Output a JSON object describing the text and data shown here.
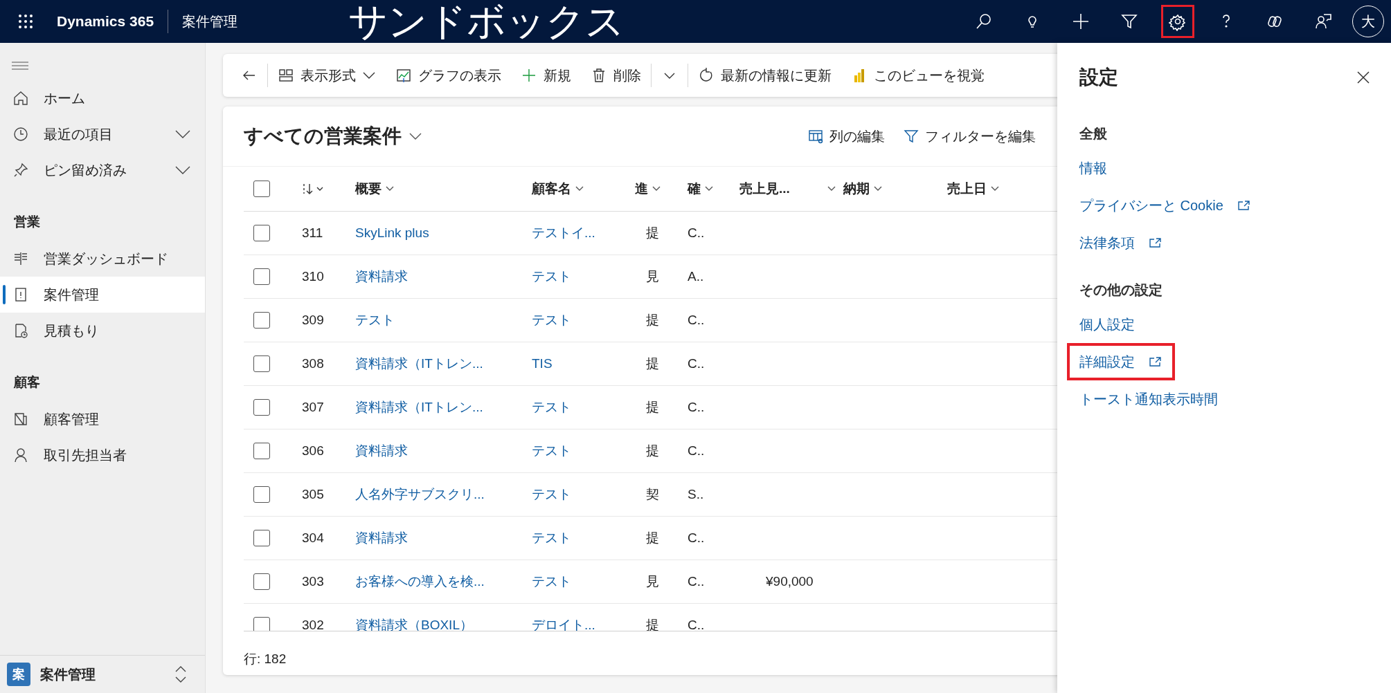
{
  "top_bar": {
    "app": "Dynamics 365",
    "area": "案件管理",
    "banner": "サンドボックス",
    "icons": [
      {
        "kind": "search",
        "highlighted": false
      },
      {
        "kind": "idea",
        "highlighted": false
      },
      {
        "kind": "add",
        "highlighted": false
      },
      {
        "kind": "filter",
        "highlighted": false
      },
      {
        "kind": "settings",
        "highlighted": true
      },
      {
        "kind": "help",
        "highlighted": false
      },
      {
        "kind": "copilot",
        "highlighted": false
      },
      {
        "kind": "feedback",
        "highlighted": false
      }
    ],
    "avatar": "大"
  },
  "sidebar": {
    "groups": [
      {
        "items": [
          {
            "kind": "home",
            "label": "ホーム",
            "expandable": false,
            "selected": false
          },
          {
            "kind": "recent",
            "label": "最近の項目",
            "expandable": true,
            "selected": false
          },
          {
            "kind": "pin",
            "label": "ピン留め済み",
            "expandable": true,
            "selected": false
          }
        ]
      },
      {
        "heading": "営業",
        "items": [
          {
            "kind": "dashboard",
            "label": "営業ダッシュボード",
            "expandable": false,
            "selected": false
          },
          {
            "kind": "case",
            "label": "案件管理",
            "expandable": false,
            "selected": true
          },
          {
            "kind": "quote",
            "label": "見積もり",
            "expandable": false,
            "selected": false
          }
        ]
      },
      {
        "heading": "顧客",
        "items": [
          {
            "kind": "account",
            "label": "顧客管理",
            "expandable": false,
            "selected": false
          },
          {
            "kind": "contact",
            "label": "取引先担当者",
            "expandable": false,
            "selected": false
          }
        ]
      }
    ],
    "footer": {
      "badge": "案",
      "label": "案件管理"
    }
  },
  "command_bar": [
    {
      "kind": "back"
    },
    {
      "kind": "view",
      "label": "表示形式"
    },
    {
      "kind": "chart",
      "label": "グラフの表示"
    },
    {
      "kind": "new",
      "label": "新規"
    },
    {
      "kind": "delete",
      "label": "削除"
    },
    {
      "kind": "more"
    },
    {
      "kind": "refresh",
      "label": "最新の情報に更新"
    },
    {
      "kind": "powerbi",
      "label": "このビューを視覚"
    }
  ],
  "view": {
    "title": "すべての営業案件",
    "actions": [
      {
        "kind": "columns",
        "label": "列の編集"
      },
      {
        "kind": "filter",
        "label": "フィルターを編集"
      }
    ]
  },
  "table": {
    "all_selected": false,
    "columns": [
      {
        "kind": "sort"
      },
      {
        "label": "概要"
      },
      {
        "label": "顧客名"
      },
      {
        "label": "進"
      },
      {
        "label": "確"
      },
      {
        "label": "売上見..."
      },
      {
        "label": "納期"
      },
      {
        "label": "売上日"
      }
    ],
    "rows": [
      {
        "selected": false,
        "cells": [
          "311",
          "SkyLink plus",
          "テストイ...",
          "提",
          "C.."
        ]
      },
      {
        "selected": false,
        "cells": [
          "310",
          "資料請求",
          "テスト",
          "見",
          "A.."
        ]
      },
      {
        "selected": false,
        "cells": [
          "309",
          "テスト",
          "テスト",
          "提",
          "C.."
        ]
      },
      {
        "selected": false,
        "cells": [
          "308",
          "資料請求（ITトレン...",
          "TIS",
          "提",
          "C.."
        ]
      },
      {
        "selected": false,
        "cells": [
          "307",
          "資料請求（ITトレン...",
          "テスト",
          "提",
          "C.."
        ]
      },
      {
        "selected": false,
        "cells": [
          "306",
          "資料請求",
          "テスト",
          "提",
          "C.."
        ]
      },
      {
        "selected": false,
        "cells": [
          "305",
          "人名外字サブスクリ...",
          "テスト",
          "契",
          "S.."
        ]
      },
      {
        "selected": false,
        "cells": [
          "304",
          "資料請求",
          "テスト",
          "提",
          "C.."
        ]
      },
      {
        "selected": false,
        "cells": [
          "303",
          "お客様への導入を検...",
          "テスト",
          "見",
          "C..",
          "¥90,000"
        ]
      },
      {
        "selected": false,
        "cells": [
          "302",
          "資料請求（BOXIL）",
          "デロイト...",
          "提",
          "C.."
        ]
      }
    ],
    "footer": "行: 182"
  },
  "settings_panel": {
    "title": "設定",
    "sections": [
      {
        "heading": "全般",
        "items": [
          {
            "label": "情報",
            "external": false,
            "highlighted": false
          },
          {
            "label": "プライバシーと Cookie",
            "external": true,
            "highlighted": false
          },
          {
            "label": "法律条項",
            "external": true,
            "highlighted": false
          }
        ]
      },
      {
        "heading": "その他の設定",
        "items": [
          {
            "label": "個人設定",
            "external": false,
            "highlighted": false
          },
          {
            "label": "詳細設定",
            "external": true,
            "highlighted": true
          },
          {
            "label": "トースト通知表示時間",
            "external": false,
            "highlighted": false
          }
        ]
      }
    ]
  }
}
